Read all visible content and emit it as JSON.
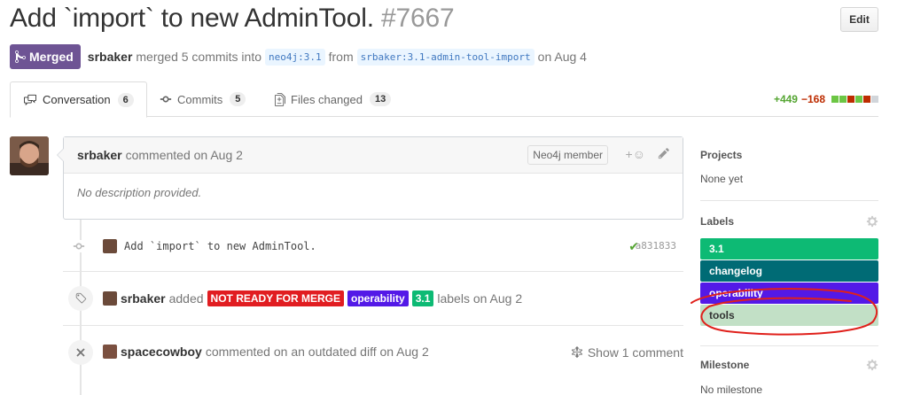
{
  "pr": {
    "title": "Add `import` to new AdminTool.",
    "number": "#7667",
    "edit_label": "Edit",
    "state": "Merged",
    "author": "srbaker",
    "merge_text": "merged 5 commits into",
    "base_branch": "neo4j:3.1",
    "from_text": "from",
    "head_branch": "srbaker:3.1-admin-tool-import",
    "date_text": "on Aug 4"
  },
  "tabs": [
    {
      "label": "Conversation",
      "count": "6"
    },
    {
      "label": "Commits",
      "count": "5"
    },
    {
      "label": "Files changed",
      "count": "13"
    }
  ],
  "diffstat": {
    "additions": "+449",
    "deletions": "−168",
    "blocks": [
      "#6cc644",
      "#6cc644",
      "#bd2c00",
      "#6cc644",
      "#bd2c00",
      "#d1d5da"
    ]
  },
  "comment": {
    "author": "srbaker",
    "action": "commented on Aug 2",
    "badge": "Neo4j member",
    "body": "No description provided."
  },
  "commit": {
    "message": "Add `import` to new AdminTool.",
    "sha": "a831833"
  },
  "label_event": {
    "author": "srbaker",
    "action": "added",
    "labels": [
      {
        "name": "NOT READY FOR MERGE",
        "color": "#e11d21"
      },
      {
        "name": "operability",
        "color": "#5319e7"
      },
      {
        "name": "3.1",
        "color": "#0dba74"
      }
    ],
    "suffix": "labels on Aug 2"
  },
  "outdated_event": {
    "author": "spacecowboy",
    "action": "commented on an outdated diff on Aug 2",
    "show_label": "Show 1 comment"
  },
  "sidebar": {
    "projects_title": "Projects",
    "projects_value": "None yet",
    "labels_title": "Labels",
    "labels": [
      {
        "name": "3.1",
        "bg": "#0dba74",
        "fg": "#ffffff"
      },
      {
        "name": "changelog",
        "bg": "#006b75",
        "fg": "#ffffff"
      },
      {
        "name": "operability",
        "bg": "#5319e7",
        "fg": "#ffffff"
      },
      {
        "name": "tools",
        "bg": "#c2e0c6",
        "fg": "#333333"
      }
    ],
    "milestone_title": "Milestone",
    "milestone_value": "No milestone"
  },
  "colors": {
    "merged": "#6e5494",
    "annotation": "#e0201b"
  }
}
